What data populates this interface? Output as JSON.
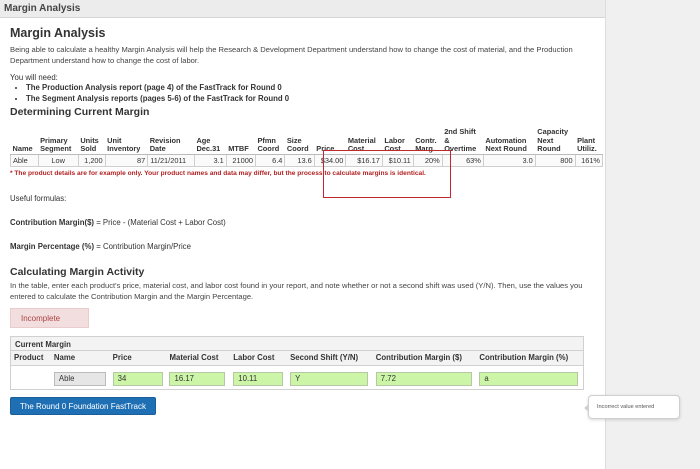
{
  "titlebar": {
    "title": "Margin Analysis"
  },
  "heading": "Margin Analysis",
  "intro": "Being able to calculate a healthy Margin Analysis will help the Research & Development Department understand how to change the cost of material, and the Production Department  understand how to change the cost of labor.",
  "needs": {
    "title": "You will need:",
    "items": [
      "The Production Analysis report (page 4) of the FastTrack for Round 0",
      "The Segment Analysis reports (pages 5-6) of the FastTrack for Round 0"
    ]
  },
  "determining": {
    "title": "Determining Current Margin",
    "headers": [
      [
        "",
        "",
        "Name"
      ],
      [
        "",
        "Primary",
        "Segment"
      ],
      [
        "",
        "Units",
        "Sold"
      ],
      [
        "",
        "Unit",
        "Inventory"
      ],
      [
        "",
        "Revision",
        "Date"
      ],
      [
        "",
        "Age",
        "Dec.31"
      ],
      [
        "",
        "",
        "MTBF"
      ],
      [
        "",
        "Pfmn",
        "Coord"
      ],
      [
        "",
        "Size",
        "Coord"
      ],
      [
        "",
        "",
        "Price"
      ],
      [
        "",
        "Material",
        "Cost"
      ],
      [
        "",
        "Labor",
        "Cost"
      ],
      [
        "",
        "Contr.",
        "Marg."
      ],
      [
        "2nd Shift",
        "&",
        "Overtime"
      ],
      [
        "",
        "Automation",
        "Next Round"
      ],
      [
        "Capacity",
        "Next",
        "Round"
      ],
      [
        "",
        "Plant",
        "Utiliz."
      ]
    ],
    "row": [
      "Able",
      "Low",
      "1,200",
      "87",
      "11/21/2011",
      "3.1",
      "21000",
      "6.4",
      "13.6",
      "$34.00",
      "$16.17",
      "$10.11",
      "20%",
      "63%",
      "3.0",
      "800",
      "161%"
    ],
    "disclaimer": "* The product details are for example only. Your product names and data may differ, but the process to calculate margins is identical."
  },
  "formulas": {
    "useful": "Useful formulas:",
    "contribution_label": "Contribution Margin($)",
    "contribution_rest": " = Price - (Material Cost + Labor Cost)",
    "percentage_label": "Margin Percentage (%)",
    "percentage_rest": " = Contribution Margin/Price"
  },
  "calculating": {
    "title": "Calculating Margin Activity",
    "instructions": "In the table, enter each product's price, material cost, and labor cost found in your report, and note whether or not a second shift was used (Y/N). Then, use the values you entered to calculate the Contribution Margin and the Margin Percentage.",
    "status": "Incomplete"
  },
  "current_margin": {
    "title": "Current Margin",
    "headers": {
      "product": "Product",
      "name": "Name",
      "price": "Price",
      "material": "Material Cost",
      "labor": "Labor Cost",
      "shift": "Second Shift (Y/N)",
      "contribution": "Contribution Margin ($)",
      "margin": "Contribution Margin (%)"
    },
    "row": {
      "name": "Able",
      "price": "34",
      "material": "16.17",
      "labor": "10.11",
      "shift": "Y",
      "contribution": "7.72",
      "margin": "a"
    }
  },
  "button": {
    "label": "The Round 0 Foundation FastTrack"
  },
  "tooltip": {
    "text": "Incorrect value entered"
  },
  "colors": {
    "accent_button": "#1f6fb5",
    "input_ok": "#ccf5a8",
    "highlight_box": "#c0282d",
    "status_incomplete": "#a94442"
  }
}
